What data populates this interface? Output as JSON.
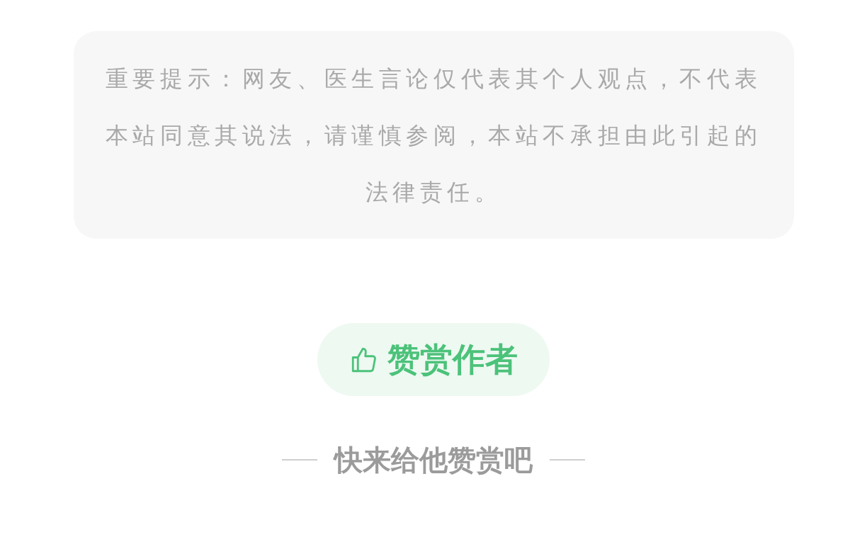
{
  "notice": {
    "text": "重要提示：网友、医生言论仅代表其个人观点，不代表本站同意其说法，请谨慎参阅，本站不承担由此引起的法律责任。"
  },
  "reward_button": {
    "label": "赞赏作者"
  },
  "prompt": {
    "text": "快来给他赞赏吧"
  }
}
